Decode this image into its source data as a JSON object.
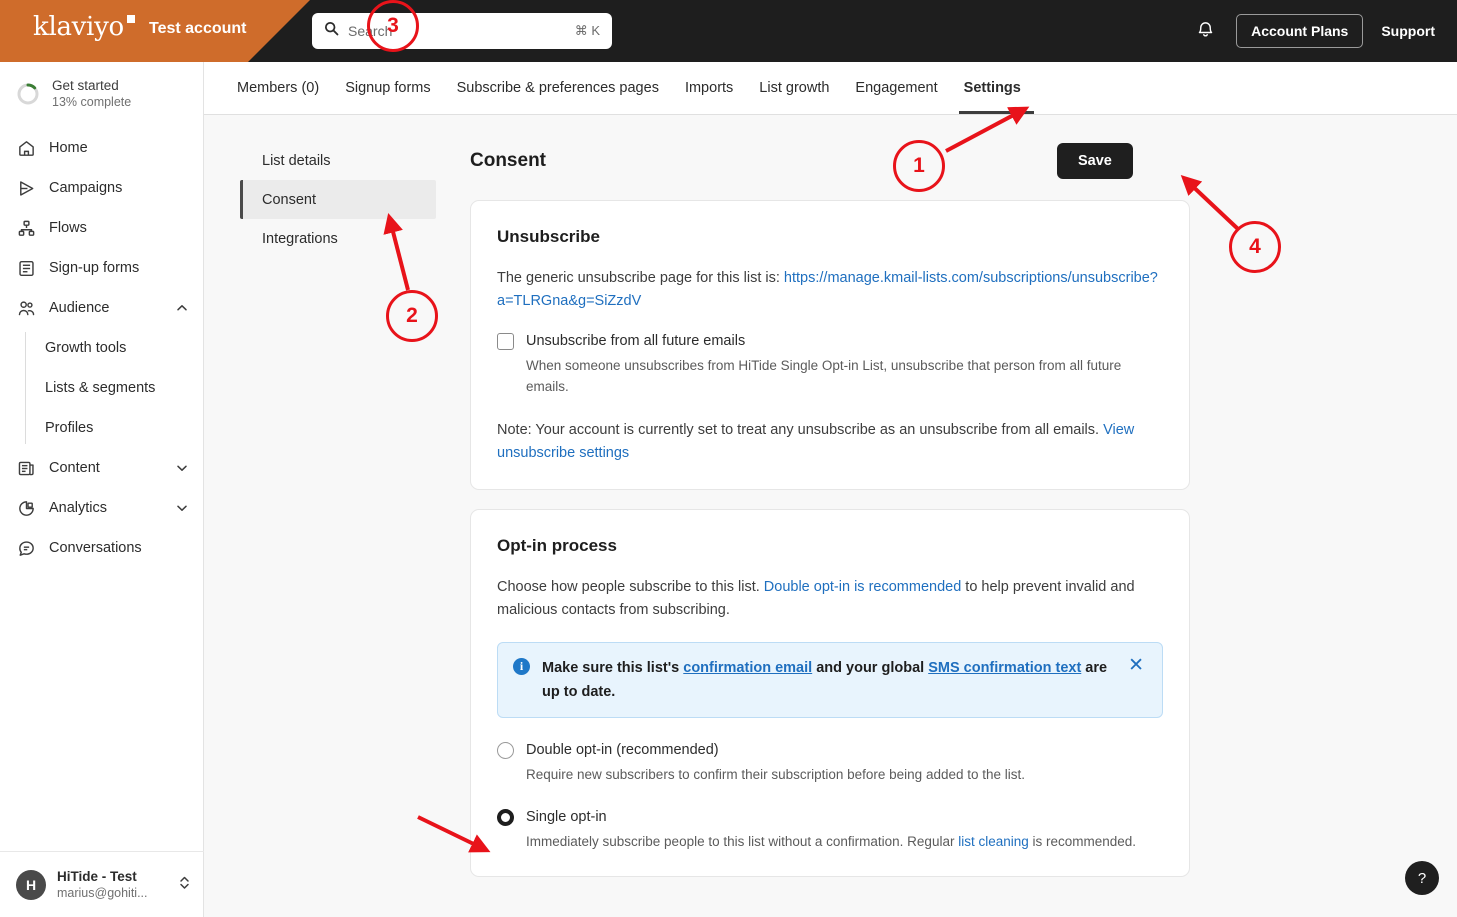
{
  "topbar": {
    "logo": "klaviyo",
    "account_name": "Test account",
    "search_placeholder": "Search",
    "search_shortcut": "⌘ K",
    "bell_icon": "bell-icon",
    "account_plans_label": "Account Plans",
    "support_label": "Support",
    "orange": "#cf6c2b",
    "dark": "#1e1e1e"
  },
  "sidebar": {
    "get_started": {
      "title": "Get started",
      "progress_text": "13% complete",
      "percent": 13
    },
    "items": [
      {
        "label": "Home",
        "icon": "home-icon",
        "expandable": false
      },
      {
        "label": "Campaigns",
        "icon": "campaigns-icon",
        "expandable": false
      },
      {
        "label": "Flows",
        "icon": "flows-icon",
        "expandable": false
      },
      {
        "label": "Sign-up forms",
        "icon": "signup-forms-icon",
        "expandable": false
      },
      {
        "label": "Audience",
        "icon": "audience-icon",
        "expandable": true,
        "expanded": true
      }
    ],
    "audience_children": [
      {
        "label": "Growth tools"
      },
      {
        "label": "Lists & segments"
      },
      {
        "label": "Profiles"
      }
    ],
    "items_after": [
      {
        "label": "Content",
        "icon": "content-icon",
        "expandable": true,
        "expanded": false
      },
      {
        "label": "Analytics",
        "icon": "analytics-icon",
        "expandable": true,
        "expanded": false
      },
      {
        "label": "Conversations",
        "icon": "conversations-icon",
        "expandable": false
      }
    ],
    "account": {
      "avatar_letter": "H",
      "name": "HiTide - Test",
      "email": "marius@gohiti...",
      "switcher_icon": "chevron-up-down-icon"
    }
  },
  "tabs": [
    {
      "label": "Members (0)",
      "active": false
    },
    {
      "label": "Signup forms",
      "active": false
    },
    {
      "label": "Subscribe & preferences pages",
      "active": false
    },
    {
      "label": "Imports",
      "active": false
    },
    {
      "label": "List growth",
      "active": false
    },
    {
      "label": "Engagement",
      "active": false
    },
    {
      "label": "Settings",
      "active": true
    }
  ],
  "settings_nav": [
    {
      "label": "List details",
      "active": false
    },
    {
      "label": "Consent",
      "active": true
    },
    {
      "label": "Integrations",
      "active": false
    }
  ],
  "page": {
    "title": "Consent",
    "save_label": "Save"
  },
  "unsubscribe": {
    "heading": "Unsubscribe",
    "intro_prefix": "The generic unsubscribe page for this list is: ",
    "url": "https://manage.kmail-lists.com/subscriptions/unsubscribe?a=TLRGna&g=SiZzdV",
    "checkbox_label": "Unsubscribe from all future emails",
    "checkbox_checked": false,
    "checkbox_desc": "When someone unsubscribes from HiTide Single Opt-in List, unsubscribe that person from all future emails.",
    "note_text": "Note: Your account is currently set to treat any unsubscribe as an unsubscribe from all emails. ",
    "note_link": "View unsubscribe settings"
  },
  "optin": {
    "heading": "Opt-in process",
    "desc_part1": "Choose how people subscribe to this list. ",
    "desc_link": "Double opt-in is recommended",
    "desc_part2": " to help prevent invalid and malicious contacts from subscribing.",
    "banner": {
      "icon": "info-icon",
      "text_part1": "Make sure this list's ",
      "link1": "confirmation email",
      "text_part2": " and your global ",
      "link2": "SMS confirmation text",
      "text_part3": " are up to date.",
      "close_icon": "close-icon"
    },
    "options": [
      {
        "label": "Double opt-in (recommended)",
        "desc": "Require new subscribers to confirm their subscription before being added to the list.",
        "selected": false
      },
      {
        "label": "Single opt-in",
        "desc_part1": "Immediately subscribe people to this list without a confirmation. Regular ",
        "desc_link": "list cleaning",
        "desc_part2": " is recommended.",
        "selected": true
      }
    ]
  },
  "help": {
    "label": "?",
    "icon": "help-icon"
  },
  "annotations": [
    {
      "number": "1",
      "target": "settings-tab"
    },
    {
      "number": "2",
      "target": "consent-nav-item"
    },
    {
      "number": "3",
      "target": "single-optin-radio"
    },
    {
      "number": "4",
      "target": "save-button"
    }
  ],
  "colors": {
    "accent_red": "#e8131a",
    "link_blue": "#1f6fbf",
    "info_bg": "#e8f4fd"
  }
}
